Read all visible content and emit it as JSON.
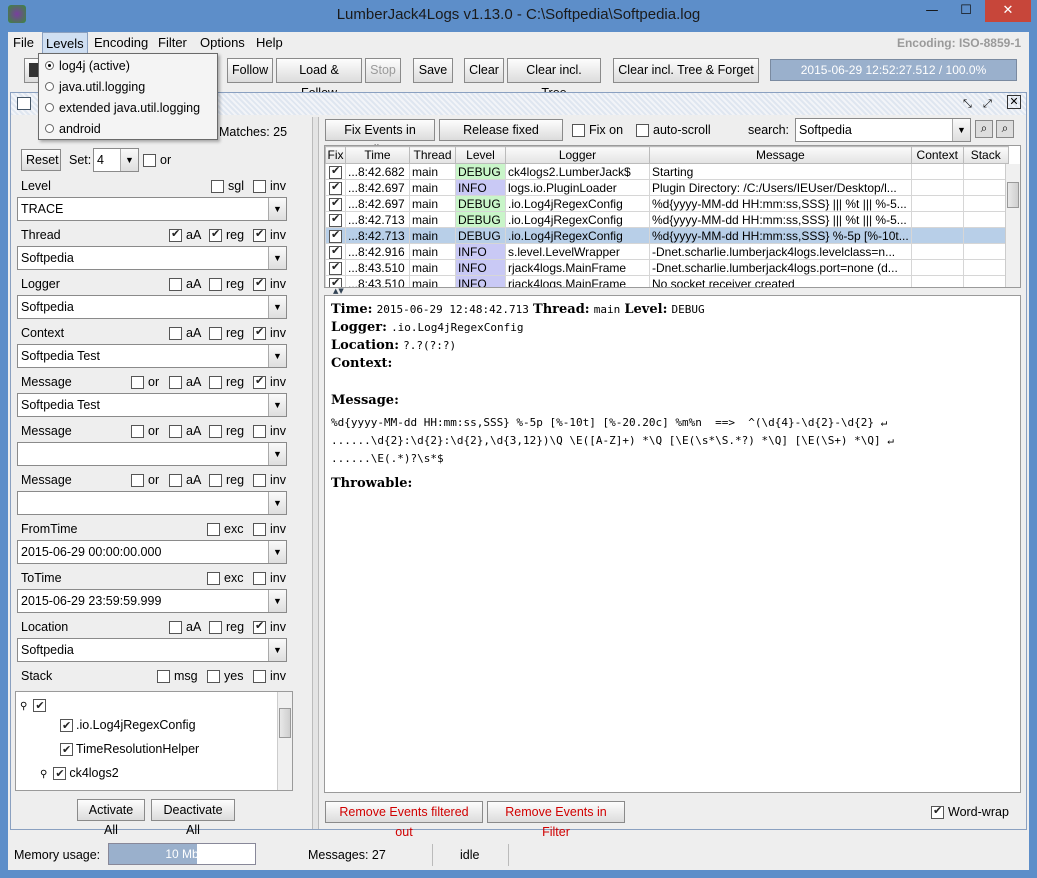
{
  "window": {
    "title": "LumberJack4Logs v1.13.0 - C:\\Softpedia\\Softpedia.log",
    "minimize": "—",
    "maximize": "☐",
    "close": "✕"
  },
  "menu": {
    "file": "File",
    "levels": "Levels",
    "encoding": "Encoding",
    "filter": "Filter",
    "options": "Options",
    "help": "Help",
    "encoding_status": "Encoding: ISO-8859-1"
  },
  "levels_menu": {
    "items": [
      "log4j (active)",
      "java.util.logging",
      "extended java.util.logging",
      "android"
    ],
    "selected": 0
  },
  "toolbar": {
    "follow": "Follow",
    "load_follow": "Load & Follow",
    "stop": "Stop",
    "save": "Save",
    "clear": "Clear",
    "clear_tree": "Clear incl. Tree",
    "clear_tree_forget": "Clear incl. Tree & Forget",
    "progress": "2015-06-29 12:52:27.512 / 100.0%"
  },
  "filter": {
    "matches": "Matches: 25",
    "reset": "Reset",
    "set_label": "Set:",
    "set_value": "4",
    "or": "or",
    "level_label": "Level",
    "sgl": "sgl",
    "inv": "inv",
    "level_value": "TRACE",
    "aA": "aA",
    "reg": "reg",
    "exc": "exc",
    "msg": "msg",
    "yes": "yes",
    "thread_label": "Thread",
    "thread_value": "Softpedia",
    "logger_label": "Logger",
    "logger_value": "Softpedia",
    "context_label": "Context",
    "context_value": "Softpedia Test",
    "message_label": "Message",
    "message1_value": "Softpedia Test",
    "message2_value": "",
    "message3_value": "",
    "fromtime_label": "FromTime",
    "fromtime_value": "2015-06-29 00:00:00.000",
    "totime_label": "ToTime",
    "totime_value": "2015-06-29 23:59:59.999",
    "location_label": "Location",
    "location_value": "Softpedia",
    "stack_label": "Stack",
    "tree": [
      ".io.Log4jRegexConfig",
      "TimeResolutionHelper",
      "ck4logs2"
    ],
    "activate_all": "Activate All",
    "deactivate_all": "Deactivate All"
  },
  "events_toolbar": {
    "fix_in_filter": "Fix Events in Filter",
    "release_fixed": "Release fixed Events",
    "fix_on": "Fix on",
    "auto_scroll": "auto-scroll",
    "search_label": "search:",
    "search_value": "Softpedia"
  },
  "table": {
    "headers": [
      "Fix",
      "Time",
      "Thread",
      "Level",
      "Logger",
      "Message",
      "Context",
      "Stack"
    ],
    "rows": [
      [
        "...8:42.682",
        "main",
        "DEBUG",
        "ck4logs2.LumberJack$",
        "Starting"
      ],
      [
        "...8:42.697",
        "main",
        "INFO",
        "logs.io.PluginLoader",
        "Plugin Directory: /C:/Users/IEUser/Desktop/l..."
      ],
      [
        "...8:42.697",
        "main",
        "DEBUG",
        ".io.Log4jRegexConfig",
        "%d{yyyy-MM-dd HH:mm:ss,SSS} ||| %t ||| %-5..."
      ],
      [
        "...8:42.713",
        "main",
        "DEBUG",
        ".io.Log4jRegexConfig",
        "%d{yyyy-MM-dd HH:mm:ss,SSS} ||| %t ||| %-5..."
      ],
      [
        "...8:42.713",
        "main",
        "DEBUG",
        ".io.Log4jRegexConfig",
        "%d{yyyy-MM-dd HH:mm:ss,SSS} %-5p [%-10t..."
      ],
      [
        "...8:42.916",
        "main",
        "INFO",
        "s.level.LevelWrapper",
        "-Dnet.scharlie.lumberjack4logs.levelclass=n..."
      ],
      [
        "...8:43.510",
        "main",
        "INFO",
        "rjack4logs.MainFrame",
        "-Dnet.scharlie.lumberjack4logs.port=none (d..."
      ],
      [
        "...8:43.510",
        "main",
        "INFO",
        "rjack4logs.MainFrame",
        "No socket receiver created"
      ]
    ]
  },
  "detail": {
    "time_label": "Time:",
    "time_value": "2015-06-29 12:48:42.713",
    "thread_label": "Thread:",
    "thread_value": "main",
    "level_label": "Level:",
    "level_value": "DEBUG",
    "logger_label": "Logger:",
    "logger_value": ".io.Log4jRegexConfig",
    "location_label": "Location:",
    "location_value": "?.?(?:?)",
    "context_label": "Context:",
    "message_label": "Message:",
    "msg_line1": "%d{yyyy-MM-dd HH:mm:ss,SSS} %-5p [%-10t] [%-20.20c] %m%n  ==>  ^(\\d{4}-\\d{2}-\\d{2} ↵",
    "msg_line2": "......\\d{2}:\\d{2}:\\d{2},\\d{3,12})\\Q \\E([A-Z]+) *\\Q [\\E(\\s*\\S.*?) *\\Q] [\\E(\\S+) *\\Q] ↵",
    "msg_line3": "......\\E(.*)?\\s*$",
    "throwable_label": "Throwable:"
  },
  "bottom": {
    "remove_filtered_out": "Remove Events filtered out",
    "remove_in_filter": "Remove Events in Filter",
    "word_wrap": "Word-wrap"
  },
  "status": {
    "memory_label": "Memory usage:",
    "memory_value": "10 Mb",
    "messages": "Messages: 27",
    "state": "idle"
  },
  "colors": {
    "accent": "#5d8ec9",
    "debug": "#c9f5c9",
    "info": "#c9c9f5",
    "remove": "#d00000"
  }
}
